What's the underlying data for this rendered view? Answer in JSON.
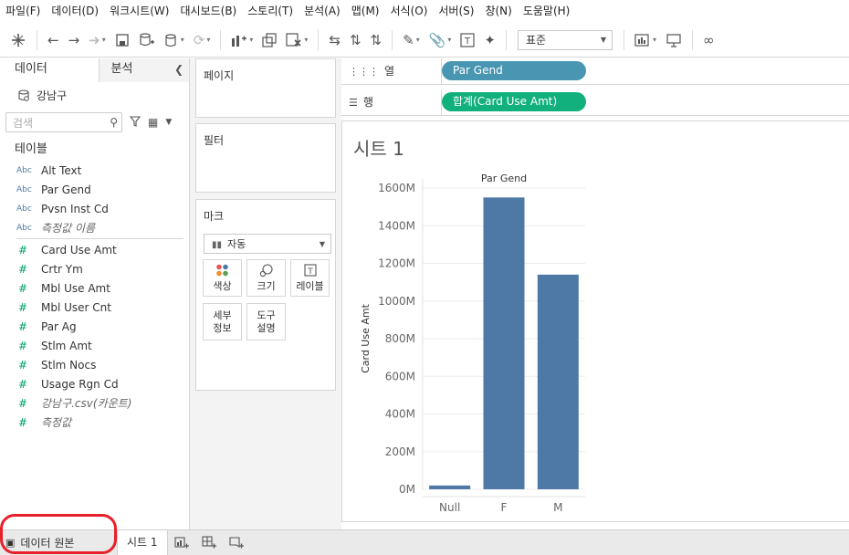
{
  "menu": [
    "파일(F)",
    "데이터(D)",
    "워크시트(W)",
    "대시보드(B)",
    "스토리(T)",
    "분석(A)",
    "맵(M)",
    "서식(O)",
    "서버(S)",
    "창(N)",
    "도움말(H)"
  ],
  "toolbar": {
    "fit_select": "표준",
    "icons": [
      "tableau-logo-icon",
      "back-icon",
      "forward-icon",
      "redo-arrow-icon",
      "save-icon",
      "new-datasource-icon",
      "pause-updates-icon",
      "refresh-icon",
      "new-worksheet-icon",
      "duplicate-sheet-icon",
      "clear-sheet-icon",
      "swap-icon",
      "sort-asc-icon",
      "sort-desc-icon",
      "highlight-icon",
      "group-icon",
      "show-labels-icon",
      "pin-icon",
      "show-me-icon",
      "presentation-icon",
      "share-icon"
    ]
  },
  "left_pane": {
    "tabs": {
      "data": "데이터",
      "analytics": "분석"
    },
    "datasource": "강남구",
    "search_placeholder": "검색",
    "tables_title": "테이블",
    "dimensions": [
      {
        "type": "Abc",
        "label": "Alt Text",
        "italic": false
      },
      {
        "type": "Abc",
        "label": "Par Gend",
        "italic": false
      },
      {
        "type": "Abc",
        "label": "Pvsn Inst Cd",
        "italic": false
      },
      {
        "type": "Abc",
        "label": "측정값 이름",
        "italic": true
      }
    ],
    "measures": [
      {
        "type": "#",
        "label": "Card Use Amt",
        "italic": false
      },
      {
        "type": "#",
        "label": "Crtr Ym",
        "italic": false
      },
      {
        "type": "#",
        "label": "Mbl Use Amt",
        "italic": false
      },
      {
        "type": "#",
        "label": "Mbl User Cnt",
        "italic": false
      },
      {
        "type": "#",
        "label": "Par Ag",
        "italic": false
      },
      {
        "type": "#",
        "label": "Stlm Amt",
        "italic": false
      },
      {
        "type": "#",
        "label": "Stlm Nocs",
        "italic": false
      },
      {
        "type": "#",
        "label": "Usage Rgn Cd",
        "italic": false
      },
      {
        "type": "#",
        "label": "강남구.csv(카운트)",
        "italic": true
      },
      {
        "type": "#",
        "label": "측정값",
        "italic": true
      }
    ]
  },
  "cards": {
    "pages": "페이지",
    "filters": "필터",
    "marks": "마크",
    "mark_type": "자동",
    "mark_buttons": {
      "color": "색상",
      "size": "크기",
      "label": "레이블",
      "detail": "세부\n정보",
      "tooltip": "도구\n설명"
    }
  },
  "shelves": {
    "columns_label": "열",
    "rows_label": "행",
    "columns_pill": "Par Gend",
    "rows_pill": "합계(Card Use Amt)"
  },
  "sheet_title": "시트 1",
  "chart_data": {
    "type": "bar",
    "title": "Par Gend",
    "categories": [
      "Null",
      "F",
      "M"
    ],
    "values": [
      20,
      1550,
      1140
    ],
    "ylabel": "Card Use Amt",
    "xlabel": "",
    "ylim": [
      0,
      1600
    ],
    "yticks": [
      "0M",
      "200M",
      "400M",
      "600M",
      "800M",
      "1000M",
      "1200M",
      "1400M",
      "1600M"
    ],
    "ytick_values": [
      0,
      200,
      400,
      600,
      800,
      1000,
      1200,
      1400,
      1600
    ],
    "bar_color": "#4e79a7",
    "grid": true
  },
  "bottom": {
    "datasource_tab": "데이터 원본",
    "sheet_tab": "시트 1"
  },
  "colors": {
    "pill_dimension": "#4996b2",
    "pill_measure": "#12b07c",
    "highlight": "#e8202a"
  }
}
